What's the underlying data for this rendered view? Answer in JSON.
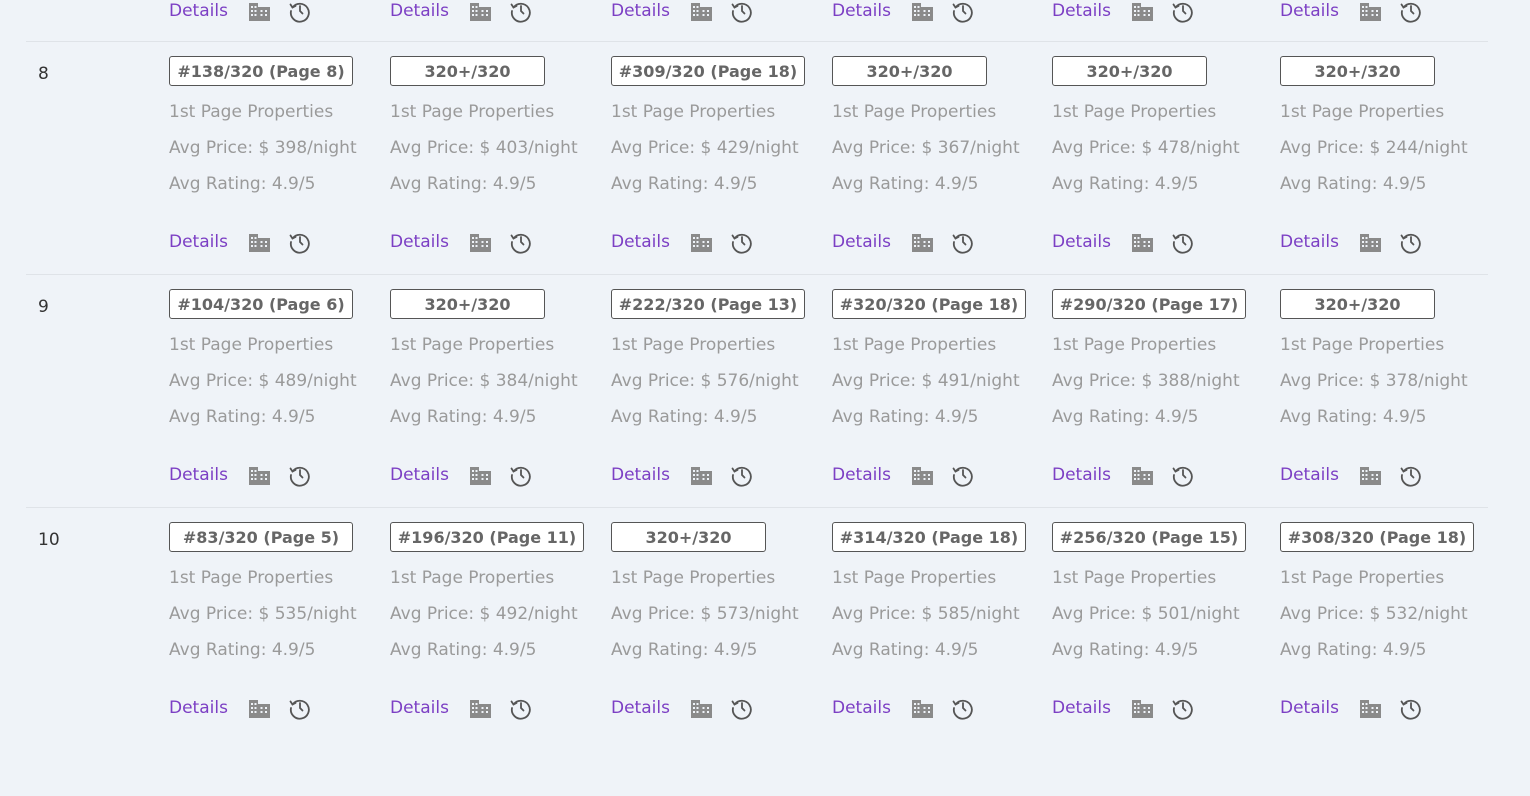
{
  "labels": {
    "details": "Details",
    "first_page": "1st Page Properties"
  },
  "colors": {
    "background": "#eff3f8",
    "link": "#7c3fc4",
    "muted_text": "#9a9a9a",
    "badge_text": "#666666",
    "badge_border": "#555555",
    "divider": "#dfe3e8",
    "icon": "#888888"
  },
  "icons": {
    "building": "building-icon",
    "history": "clock-history-icon"
  },
  "partial_row": {
    "cells": [
      {},
      {},
      {},
      {},
      {},
      {}
    ]
  },
  "rows": [
    {
      "number": "8",
      "cells": [
        {
          "rank": "#138/320 (Page 8)",
          "price": "Avg Price: $ 398/night",
          "rating": "Avg Rating: 4.9/5"
        },
        {
          "rank": "320+/320",
          "price": "Avg Price: $ 403/night",
          "rating": "Avg Rating: 4.9/5"
        },
        {
          "rank": "#309/320 (Page 18)",
          "price": "Avg Price: $ 429/night",
          "rating": "Avg Rating: 4.9/5"
        },
        {
          "rank": "320+/320",
          "price": "Avg Price: $ 367/night",
          "rating": "Avg Rating: 4.9/5"
        },
        {
          "rank": "320+/320",
          "price": "Avg Price: $ 478/night",
          "rating": "Avg Rating: 4.9/5"
        },
        {
          "rank": "320+/320",
          "price": "Avg Price: $ 244/night",
          "rating": "Avg Rating: 4.9/5"
        }
      ]
    },
    {
      "number": "9",
      "cells": [
        {
          "rank": "#104/320 (Page 6)",
          "price": "Avg Price: $ 489/night",
          "rating": "Avg Rating: 4.9/5"
        },
        {
          "rank": "320+/320",
          "price": "Avg Price: $ 384/night",
          "rating": "Avg Rating: 4.9/5"
        },
        {
          "rank": "#222/320 (Page 13)",
          "price": "Avg Price: $ 576/night",
          "rating": "Avg Rating: 4.9/5"
        },
        {
          "rank": "#320/320 (Page 18)",
          "price": "Avg Price: $ 491/night",
          "rating": "Avg Rating: 4.9/5"
        },
        {
          "rank": "#290/320 (Page 17)",
          "price": "Avg Price: $ 388/night",
          "rating": "Avg Rating: 4.9/5"
        },
        {
          "rank": "320+/320",
          "price": "Avg Price: $ 378/night",
          "rating": "Avg Rating: 4.9/5"
        }
      ]
    },
    {
      "number": "10",
      "cells": [
        {
          "rank": "#83/320 (Page 5)",
          "price": "Avg Price: $ 535/night",
          "rating": "Avg Rating: 4.9/5"
        },
        {
          "rank": "#196/320 (Page 11)",
          "price": "Avg Price: $ 492/night",
          "rating": "Avg Rating: 4.9/5"
        },
        {
          "rank": "320+/320",
          "price": "Avg Price: $ 573/night",
          "rating": "Avg Rating: 4.9/5"
        },
        {
          "rank": "#314/320 (Page 18)",
          "price": "Avg Price: $ 585/night",
          "rating": "Avg Rating: 4.9/5"
        },
        {
          "rank": "#256/320 (Page 15)",
          "price": "Avg Price: $ 501/night",
          "rating": "Avg Rating: 4.9/5"
        },
        {
          "rank": "#308/320 (Page 18)",
          "price": "Avg Price: $ 532/night",
          "rating": "Avg Rating: 4.9/5"
        }
      ]
    }
  ]
}
